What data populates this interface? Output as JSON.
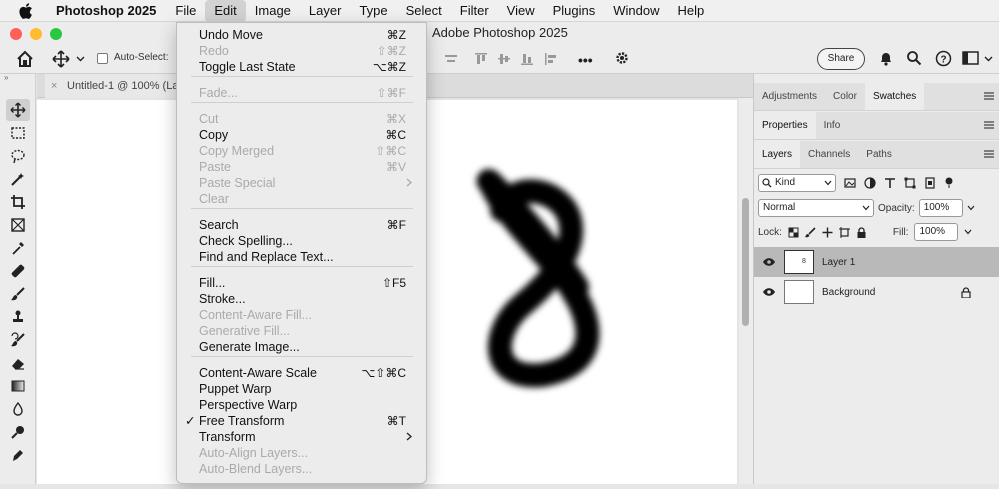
{
  "menubar": {
    "app_name": "Photoshop 2025",
    "items": [
      "File",
      "Edit",
      "Image",
      "Layer",
      "Type",
      "Select",
      "Filter",
      "View",
      "Plugins",
      "Window",
      "Help"
    ],
    "active": "Edit"
  },
  "window": {
    "title": "Adobe Photoshop 2025"
  },
  "options_bar": {
    "auto_select_label": "Auto-Select:",
    "share_label": "Share"
  },
  "document": {
    "tab_title": "Untitled-1 @ 100% (Lay"
  },
  "edit_menu": {
    "items": [
      {
        "label": "Undo Move",
        "shortcut": "⌘Z",
        "disabled": false
      },
      {
        "label": "Redo",
        "shortcut": "⇧⌘Z",
        "disabled": true
      },
      {
        "label": "Toggle Last State",
        "shortcut": "⌥⌘Z",
        "disabled": false
      },
      {
        "label": "Fade...",
        "shortcut": "⇧⌘F",
        "disabled": true
      },
      {
        "label": "Cut",
        "shortcut": "⌘X",
        "disabled": true
      },
      {
        "label": "Copy",
        "shortcut": "⌘C",
        "disabled": false
      },
      {
        "label": "Copy Merged",
        "shortcut": "⇧⌘C",
        "disabled": true
      },
      {
        "label": "Paste",
        "shortcut": "⌘V",
        "disabled": true
      },
      {
        "label": "Paste Special",
        "shortcut": "",
        "disabled": true
      },
      {
        "label": "Clear",
        "shortcut": "",
        "disabled": true
      },
      {
        "label": "Search",
        "shortcut": "⌘F",
        "disabled": false
      },
      {
        "label": "Check Spelling...",
        "shortcut": "",
        "disabled": false
      },
      {
        "label": "Find and Replace Text...",
        "shortcut": "",
        "disabled": false
      },
      {
        "label": "Fill...",
        "shortcut": "⇧F5",
        "disabled": false
      },
      {
        "label": "Stroke...",
        "shortcut": "",
        "disabled": false
      },
      {
        "label": "Content-Aware Fill...",
        "shortcut": "",
        "disabled": true
      },
      {
        "label": "Generative Fill...",
        "shortcut": "",
        "disabled": true
      },
      {
        "label": "Generate Image...",
        "shortcut": "",
        "disabled": false
      },
      {
        "label": "Content-Aware Scale",
        "shortcut": "⌥⇧⌘C",
        "disabled": false
      },
      {
        "label": "Puppet Warp",
        "shortcut": "",
        "disabled": false
      },
      {
        "label": "Perspective Warp",
        "shortcut": "",
        "disabled": false
      },
      {
        "label": "Free Transform",
        "shortcut": "⌘T",
        "disabled": false,
        "checked": true
      },
      {
        "label": "Transform",
        "shortcut": "",
        "disabled": false
      },
      {
        "label": "Auto-Align Layers...",
        "shortcut": "",
        "disabled": true
      },
      {
        "label": "Auto-Blend Layers...",
        "shortcut": "",
        "disabled": true
      }
    ]
  },
  "panels": {
    "top_tabs": [
      "Adjustments",
      "Color",
      "Swatches"
    ],
    "top_active": "Swatches",
    "mid_tabs": [
      "Properties",
      "Info"
    ],
    "mid_active": "Properties",
    "layer_tabs": [
      "Layers",
      "Channels",
      "Paths"
    ],
    "layer_active": "Layers",
    "kind_filter": "Kind",
    "blend_mode": "Normal",
    "opacity_label": "Opacity:",
    "opacity_value": "100%",
    "lock_label": "Lock:",
    "fill_label": "Fill:",
    "fill_value": "100%",
    "layers": [
      {
        "name": "Layer 1",
        "selected": true
      },
      {
        "name": "Background",
        "selected": false,
        "locked": true
      }
    ]
  },
  "colors": {
    "traffic_close": "#ff5f57",
    "traffic_min": "#febc2e",
    "traffic_max": "#28c840"
  }
}
